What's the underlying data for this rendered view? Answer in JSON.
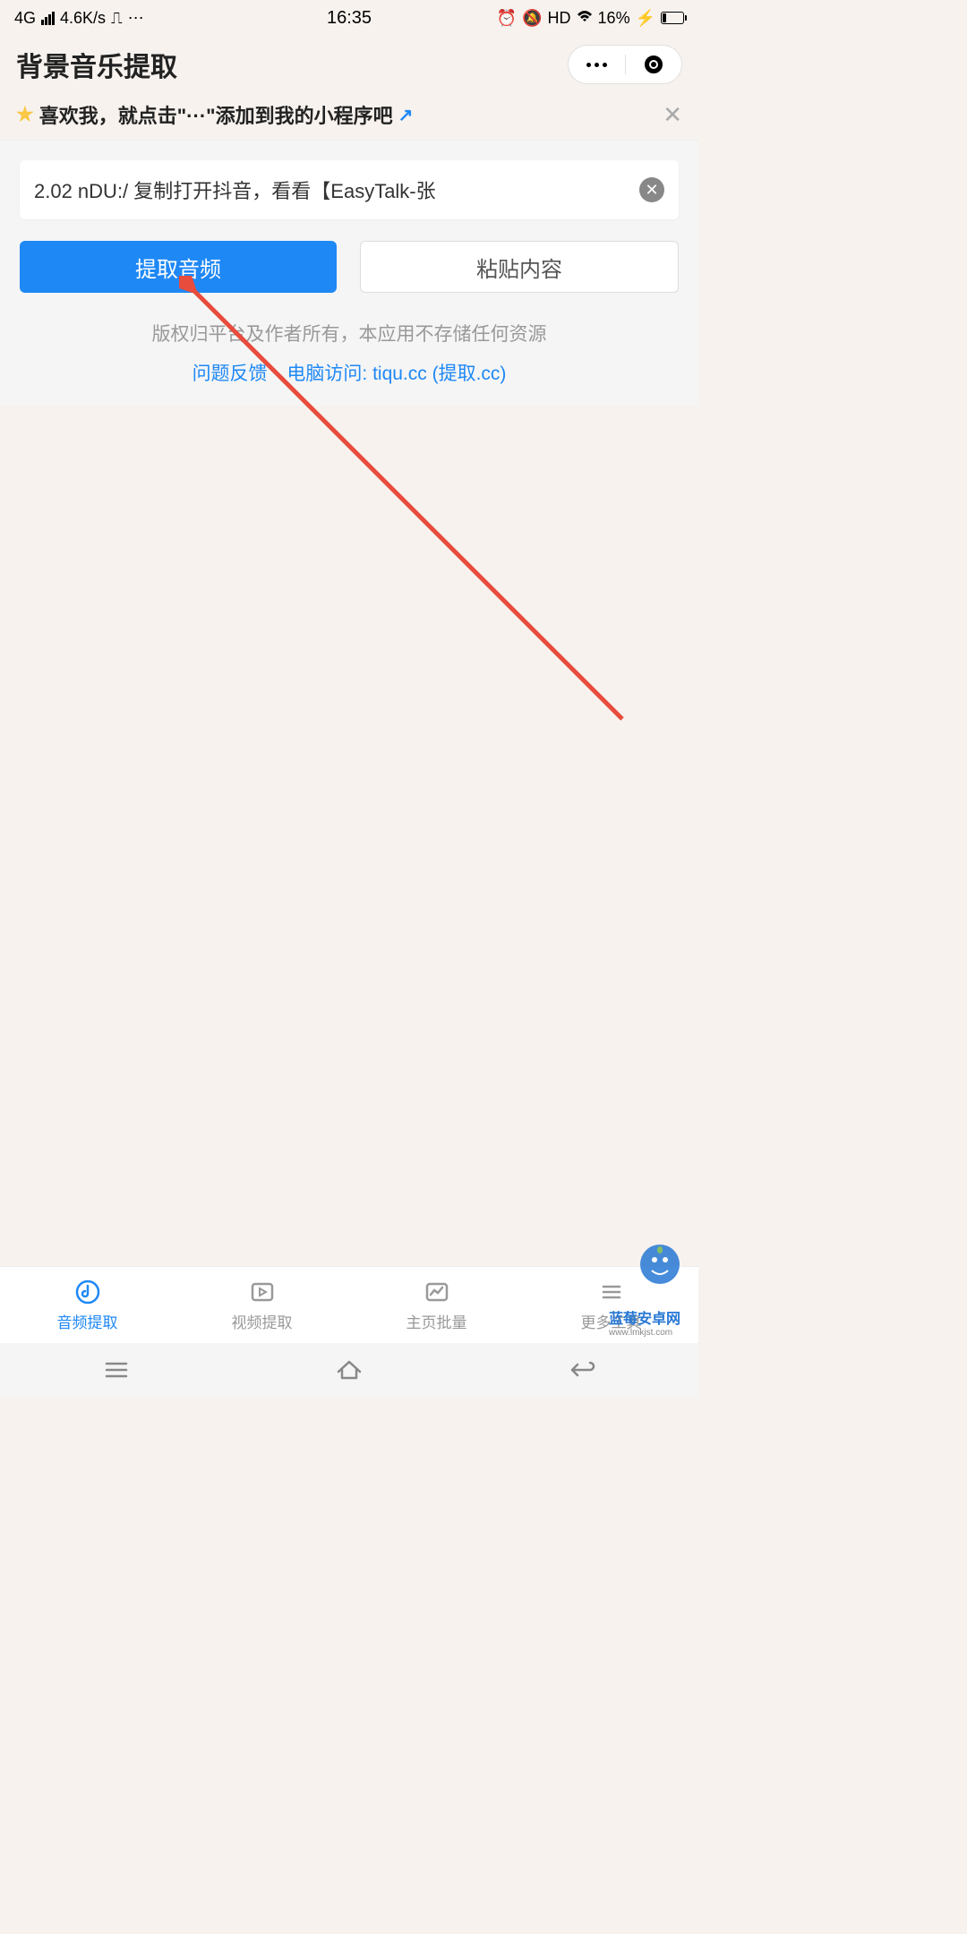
{
  "status_bar": {
    "network_type": "4G",
    "speed": "4.6K/s",
    "time": "16:35",
    "hd": "HD",
    "battery_pct": "16%"
  },
  "header": {
    "title": "背景音乐提取"
  },
  "banner": {
    "text": "喜欢我，就点击\"···\"添加到我的小程序吧"
  },
  "input": {
    "value": "2.02 nDU:/ 复制打开抖音，看看【EasyTalk-张"
  },
  "buttons": {
    "extract": "提取音频",
    "paste": "粘贴内容"
  },
  "copyright": "版权归平台及作者所有，本应用不存储任何资源",
  "links": {
    "feedback": "问题反馈",
    "pc_access": "电脑访问: tiqu.cc (提取.cc)"
  },
  "tabs": {
    "audio": "音频提取",
    "video": "视频提取",
    "batch": "主页批量",
    "more": "更多工具"
  },
  "watermark": {
    "brand": "蓝莓安卓网",
    "url": "www.lmkjst.com"
  }
}
